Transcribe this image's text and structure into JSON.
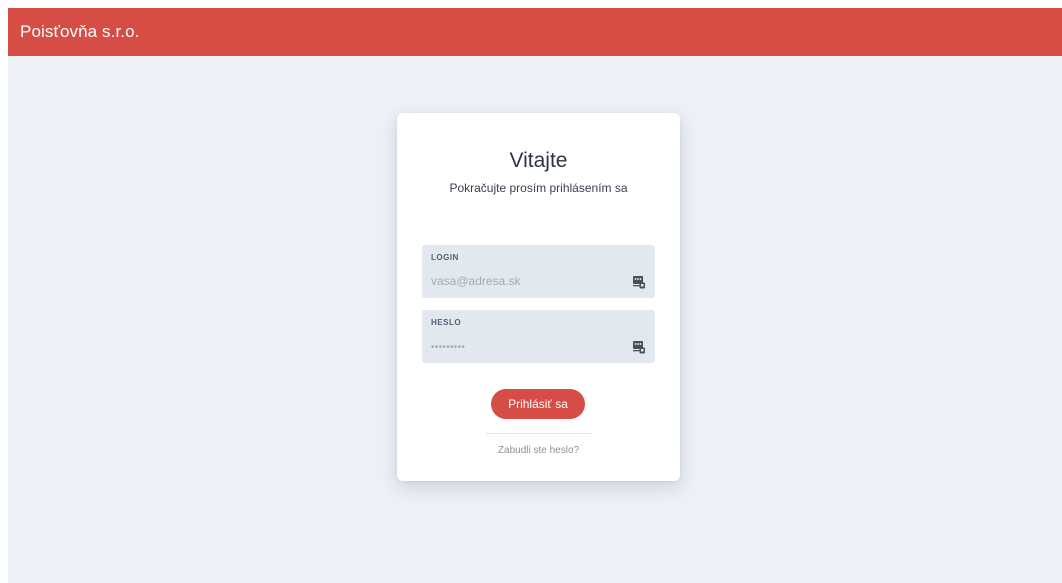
{
  "navbar": {
    "brand": "Poisťovňa s.r.o."
  },
  "login_card": {
    "title": "Vitajte",
    "subtitle": "Pokračujte prosím prihlásením sa",
    "login_field": {
      "label": "LOGIN",
      "value": "",
      "placeholder": "vasa@adresa.sk",
      "icon": "keychain-icon"
    },
    "password_field": {
      "label": "HESLO",
      "value": "",
      "placeholder": "•••••••••",
      "icon": "keychain-icon"
    },
    "submit_label": "Prihlásiť sa",
    "forgot_link": "Zabudli ste heslo?"
  },
  "colors": {
    "accent": "#d64d45",
    "page_background": "#edf1f6",
    "field_background": "#e3e8ef"
  }
}
